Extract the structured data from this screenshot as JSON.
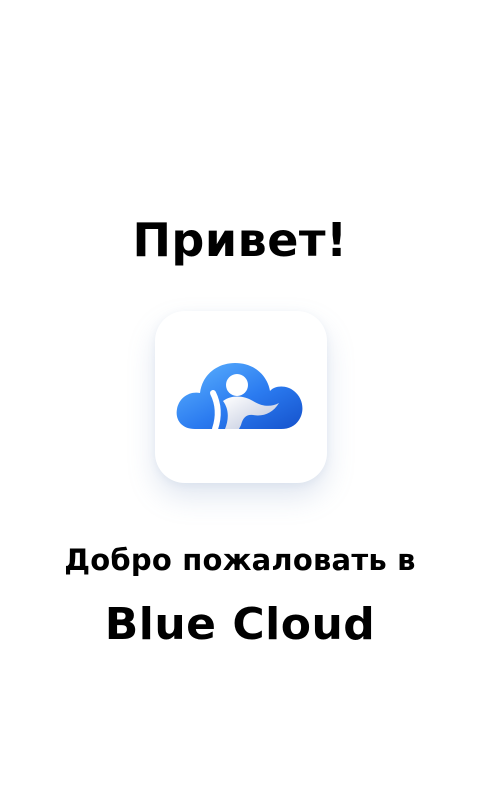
{
  "greeting": {
    "title": "Привет!"
  },
  "logo": {
    "icon": "cloud-logo-icon",
    "accent": "#1F6FE6",
    "accent_light": "#5FB5FF"
  },
  "welcome": {
    "line1": "Добро пожаловать в",
    "brand": "Blue Cloud"
  }
}
